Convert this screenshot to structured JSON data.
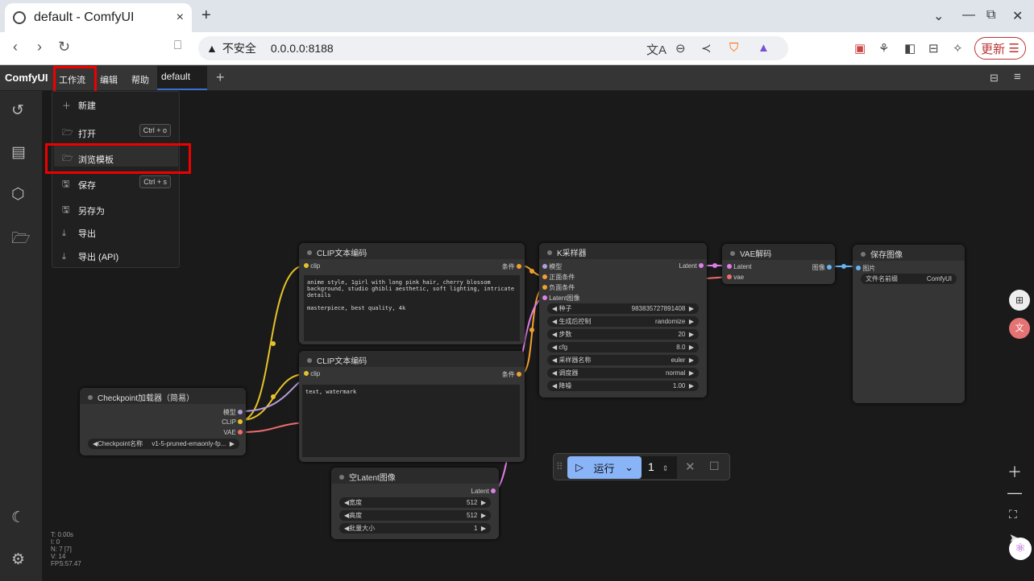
{
  "browser": {
    "tab_title": "default - ComfyUI",
    "close": "×",
    "new_tab": "+",
    "security": "不安全",
    "url": "0.0.0.0:8188",
    "update": "更新"
  },
  "app": {
    "logo": "ComfyUI",
    "menu": [
      "工作流",
      "编辑",
      "帮助"
    ],
    "workflow_tab": "default",
    "add_tab": "+"
  },
  "workflow_menu": {
    "items": [
      {
        "label": "新建",
        "icon": "plus-icon",
        "glyph": "＋"
      },
      {
        "label": "打开",
        "icon": "folder-open-icon",
        "glyph": "🗁",
        "shortcut": "Ctrl + o"
      },
      {
        "label": "浏览模板",
        "icon": "folder-open-icon",
        "glyph": "🗁"
      },
      {
        "label": "保存",
        "icon": "save-icon",
        "glyph": "🖫",
        "shortcut": "Ctrl + s"
      },
      {
        "label": "另存为",
        "icon": "save-as-icon",
        "glyph": "🖫"
      },
      {
        "label": "导出",
        "icon": "download-icon",
        "glyph": "⤓"
      },
      {
        "label": "导出 (API)",
        "icon": "download-api-icon",
        "glyph": "⤓"
      }
    ]
  },
  "nodes": {
    "clip1": {
      "title": "CLIP文本编码",
      "in": "clip",
      "out": "条件",
      "text": "anime style, 1girl with long pink hair, cherry blossom background, studio ghibli aesthetic, soft lighting, intricate details\n\nmasterpiece, best quality, 4k"
    },
    "clip2": {
      "title": "CLIP文本编码",
      "in": "clip",
      "out": "条件",
      "text": "text, watermark"
    },
    "ksampler": {
      "title": "K采样器",
      "inputs": [
        "模型",
        "正面条件",
        "负面条件",
        "Latent图像"
      ],
      "out": "Latent",
      "widgets": [
        {
          "label": "种子",
          "value": "983835727891408"
        },
        {
          "label": "生成后控制",
          "value": "randomize"
        },
        {
          "label": "步数",
          "value": "20"
        },
        {
          "label": "cfg",
          "value": "8.0"
        },
        {
          "label": "采样器名称",
          "value": "euler"
        },
        {
          "label": "调度器",
          "value": "normal"
        },
        {
          "label": "降噪",
          "value": "1.00"
        }
      ]
    },
    "vae": {
      "title": "VAE解码",
      "inputs": [
        "Latent",
        "vae"
      ],
      "out": "图像"
    },
    "save": {
      "title": "保存图像",
      "in": "图片",
      "widget_label": "文件名前缀",
      "widget_value": "ComfyUI"
    },
    "ckpt": {
      "title": "Checkpoint加载器（简易）",
      "outputs": [
        "模型",
        "CLIP",
        "VAE"
      ],
      "widget_label": "Checkpoint名称",
      "widget_value": "v1-5-pruned-emaonly-fp..."
    },
    "latent": {
      "title": "空Latent图像",
      "out": "Latent",
      "widgets": [
        {
          "label": "宽度",
          "value": "512"
        },
        {
          "label": "高度",
          "value": "512"
        },
        {
          "label": "批量大小",
          "value": "1"
        }
      ]
    }
  },
  "runbar": {
    "run": "运行",
    "queue": "1"
  },
  "stats": {
    "t": "T: 0.00s",
    "i": "I: 0",
    "n": "N: 7 [7]",
    "v": "V: 14",
    "fps": "FPS:57.47"
  }
}
